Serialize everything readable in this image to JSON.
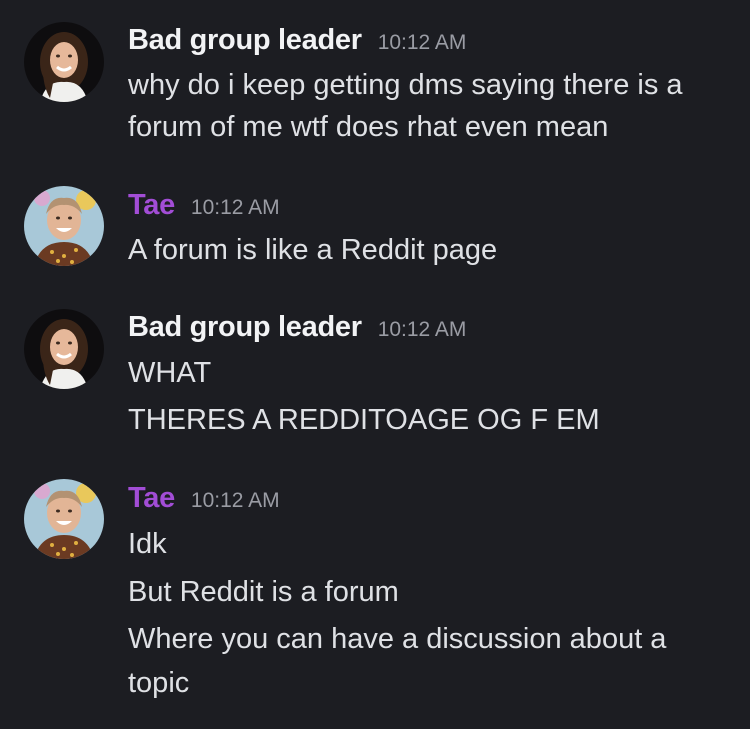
{
  "colors": {
    "background": "#1c1d22",
    "username_bad_group_leader": "#f2f3f5",
    "username_tae": "#a24dd6",
    "timestamp": "#9a9ca4",
    "message_text": "#dfe1e5"
  },
  "messages": [
    {
      "author": "Bad group leader",
      "time": "10:12 AM",
      "avatar_icon": "avatar-photo",
      "lines": [
        "why do i keep getting dms saying there is a",
        "forum of me wtf does rhat even mean"
      ]
    },
    {
      "author": "Tae",
      "time": "10:12 AM",
      "avatar_icon": "avatar-photo",
      "lines": [
        "A forum is like a Reddit page"
      ]
    },
    {
      "author": "Bad group leader",
      "time": "10:12 AM",
      "avatar_icon": "avatar-photo",
      "lines": [
        "WHAT",
        "THERES A REDDITOAGE OG F EM"
      ]
    },
    {
      "author": "Tae",
      "time": "10:12 AM",
      "avatar_icon": "avatar-photo",
      "lines": [
        "Idk",
        "But Reddit is a forum",
        "Where you can have a discussion about a",
        "topic"
      ]
    }
  ]
}
